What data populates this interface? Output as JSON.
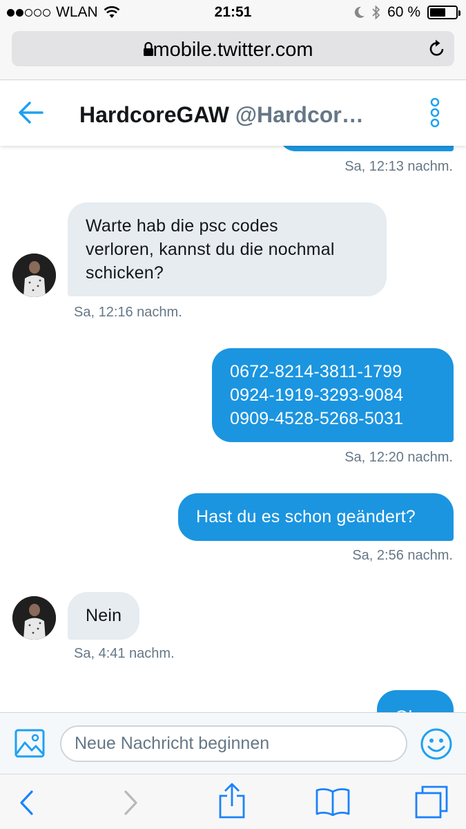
{
  "status_bar": {
    "carrier": "WLAN",
    "signal_bars_filled": 2,
    "signal_bars_total": 5,
    "time": "21:51",
    "battery": "60 %",
    "battery_level": 0.6
  },
  "browser": {
    "url": "mobile.twitter.com"
  },
  "header": {
    "name": "HardcoreGAW",
    "handle": "@Hardcor…"
  },
  "messages": [
    {
      "direction": "out",
      "text": "",
      "timestamp": "Sa, 12:13 nachm."
    },
    {
      "direction": "in",
      "text": "Warte hab die psc codes\nverloren, kannst du die nochmal\nschicken?",
      "timestamp": "Sa, 12:16 nachm."
    },
    {
      "direction": "out",
      "text": "0672-8214-3811-1799\n0924-1919-3293-9084\n0909-4528-5268-5031",
      "timestamp": "Sa, 12:20 nachm."
    },
    {
      "direction": "out",
      "text": "Hast du es schon geändert?",
      "timestamp": "Sa, 2:56 nachm."
    },
    {
      "direction": "in",
      "text": "Nein",
      "timestamp": "Sa, 4:41 nachm."
    },
    {
      "direction": "out",
      "text": "Ok",
      "timestamp": ""
    }
  ],
  "composer": {
    "placeholder": "Neue Nachricht beginnen"
  },
  "colors": {
    "twitter_blue": "#1b95e0",
    "incoming_bubble": "#e6ecf0",
    "muted_text": "#657786",
    "safari_blue": "#1a82fb"
  }
}
